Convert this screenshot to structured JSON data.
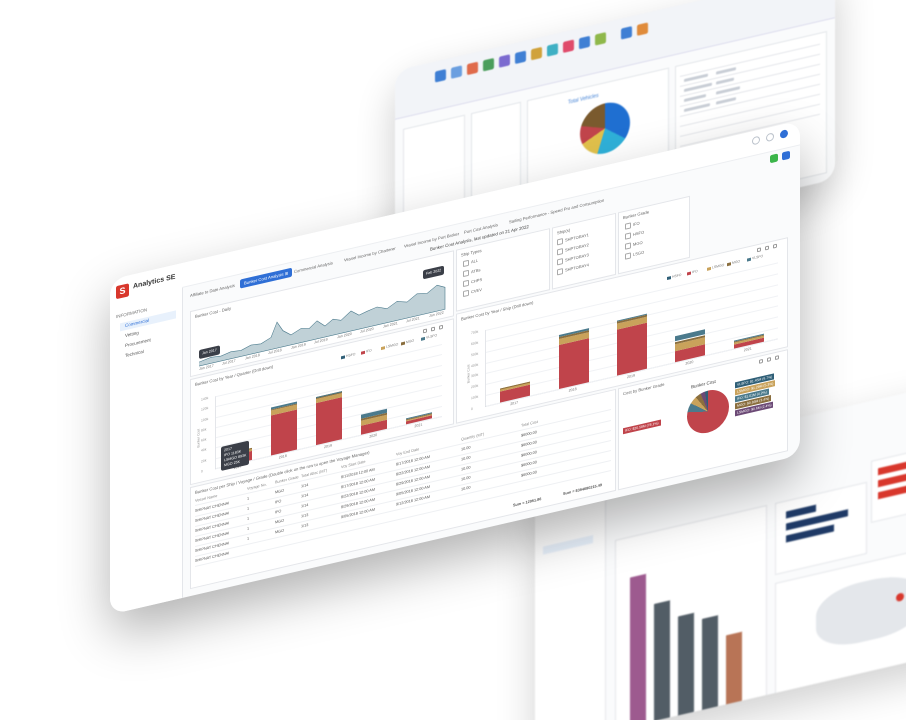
{
  "app": {
    "name": "Analytics SE",
    "logo_letter": "S",
    "sidebar_section": "INFORMATION",
    "sidebar_items": [
      "Commercial",
      "Vetting",
      "Procurement",
      "Technical"
    ],
    "active_item": 0
  },
  "tabs": {
    "items": [
      "Affiliate to Date Analysis",
      "Bunker Cost Analysis",
      "Commercial Analysis",
      "Vessel Income by Charterer",
      "Vessel Income by Port Broker",
      "Port Cost Analysis",
      "Sailing Performance - Speed Pro and Consumption"
    ],
    "active": 1,
    "active_badge": "⊞"
  },
  "main": {
    "title": "Bunker Cost Analysis, last updated on 21 Apr 2022",
    "daily": {
      "title": "Bunker Cost - Daily",
      "date_labels": [
        "Jan 2017",
        "Jul 2017",
        "Jan 2018",
        "Jul 2018",
        "Jan 2019",
        "Jul 2019",
        "Jan 2020",
        "Jul 2020",
        "Jan 2021",
        "Jul 2021",
        "Jan 2022"
      ],
      "tooltip_left": "Jan 2017",
      "tooltip_right": "Feb 2022"
    },
    "quarter": {
      "title": "Bunker Cost by Year / Quarter (Drill down)",
      "ylabel": "Bunker Cost",
      "categories": [
        "2017",
        "2018",
        "2019",
        "2020",
        "2021"
      ],
      "yticks": [
        "0",
        "20k",
        "40k",
        "60k",
        "80k",
        "100k",
        "120k",
        "140k"
      ],
      "tooltip": [
        "2017",
        "IFO 1183K",
        "LSMGO 893K",
        "MGO 25K"
      ]
    },
    "year": {
      "title": "Bunker Cost by Year / Ship (Drill down)",
      "ylabel": "Bunker Cost",
      "categories": [
        "2017",
        "2018",
        "2019",
        "2020",
        "2021"
      ],
      "yticks": [
        "0",
        "100k",
        "200k",
        "300k",
        "400k",
        "500k",
        "600k",
        "700k"
      ]
    },
    "legend": [
      "HSFO",
      "IFO",
      "LSMGO",
      "MGO",
      "VLSFO"
    ],
    "ship_type": {
      "title": "Ship Types",
      "options": [
        "ALL",
        "ATBs",
        "CHPS",
        "CVEV"
      ]
    },
    "ships": {
      "title": "Ship(s)",
      "options": [
        "SHPTORAY1",
        "SHPTORAY2",
        "SHPTORAY3",
        "SHPTORAY4"
      ]
    },
    "grade": {
      "title": "Bunker Grade",
      "options": [
        "IFO",
        "HSFO",
        "MGO",
        "LSGO"
      ]
    },
    "table": {
      "caption": "Bunker Cost per Ship / Voyage / Grade (Double click on the row to open the Voyage Manager)",
      "headers": [
        "Vessel Name",
        "Voyage No.",
        "Bunker Grade",
        "Total Alloc (MT)",
        "Voy Start Date",
        "Voy End Date",
        "Quantity (MT)",
        "Total Cost"
      ],
      "rows": [
        [
          "SHIPNAT CHENNAI",
          "1",
          "MGO",
          "1/14",
          "8/11/2018 12:00 AM",
          "8/17/2018 12:00 AM",
          "10.00",
          "$6000.00"
        ],
        [
          "SHIPNAT CHENNAI",
          "1",
          "IFO",
          "1/14",
          "8/17/2018 12:00 AM",
          "8/22/2018 12:00 AM",
          "10.00",
          "$6000.00"
        ],
        [
          "SHIPNAT CHENNAI",
          "1",
          "IFO",
          "1/14",
          "8/22/2018 12:00 AM",
          "8/29/2018 12:00 AM",
          "10.00",
          "$6000.00"
        ],
        [
          "SHIPNAT CHENNAI",
          "1",
          "MGO",
          "1/13",
          "8/29/2018 12:00 AM",
          "9/05/2018 12:00 AM",
          "10.00",
          "$6000.00"
        ],
        [
          "SHIPNAT CHENNAI",
          "1",
          "MGO",
          "1/13",
          "9/05/2018 12:00 AM",
          "9/12/2018 12:00 AM",
          "10.00",
          "$6000.00"
        ],
        [
          "SHIPNAT CHENNAI",
          "",
          "",
          "",
          "",
          "",
          "",
          ""
        ]
      ],
      "sum_qty": "Sum = 12951.86",
      "sum_cost": "Sum = $394680215.49"
    },
    "pie": {
      "title": "Cost by Bunker Grade",
      "label": "Bunker Cost",
      "tags": [
        "VLSFO: $1.45M (6.7%)",
        "LSMGO: $1.29M (5.3%)",
        "IFO: $1.01M (4.2%)",
        "MGO: $0.83M (3.4%)",
        "LSMGO: $0.6M (2.4%)",
        "IFO: $20.58M (78.1%)"
      ]
    }
  },
  "back_screen": {
    "chart_title": "Total Vehicles"
  },
  "colors": {
    "ifo": "#c0444b",
    "lsmgo": "#c9a25b",
    "mgo": "#8a6e3e",
    "vlsfo": "#4b7a8c",
    "hsfo": "#2f5f77",
    "accent": "#2f6fd6",
    "brand": "#d8372c"
  }
}
